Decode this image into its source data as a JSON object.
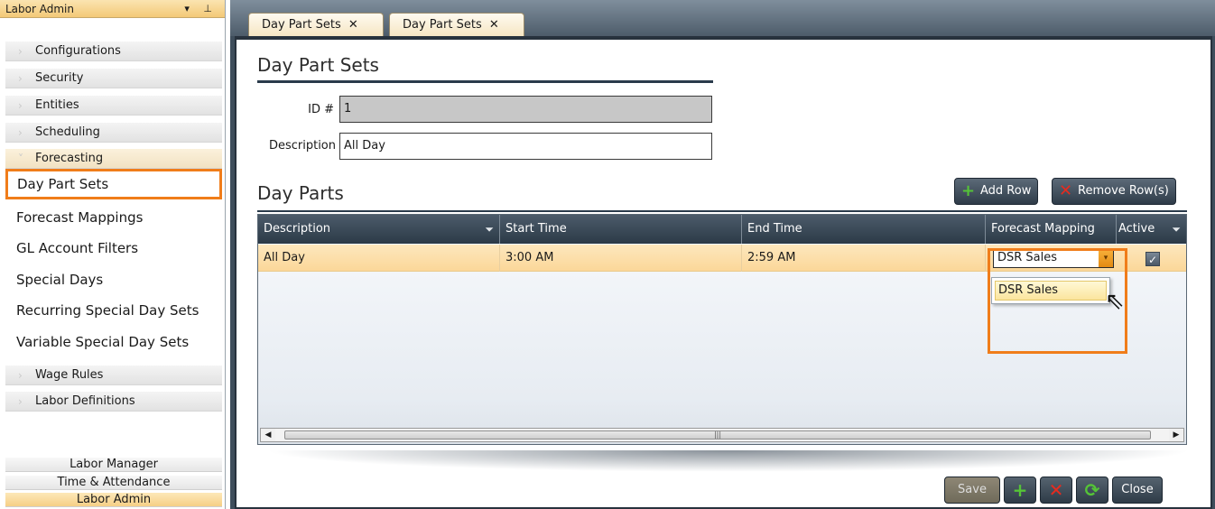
{
  "sidebar": {
    "title": "Labor Admin",
    "header_controls": "▾ ⊥",
    "groups_top": [
      {
        "label": "Configurations"
      },
      {
        "label": "Security"
      },
      {
        "label": "Entities"
      },
      {
        "label": "Scheduling"
      },
      {
        "label": "Forecasting"
      }
    ],
    "items": [
      {
        "label": "Day Part Sets"
      },
      {
        "label": "Forecast Mappings"
      },
      {
        "label": "GL Account Filters"
      },
      {
        "label": "Special Days"
      },
      {
        "label": "Recurring Special Day Sets"
      },
      {
        "label": "Variable Special Day Sets"
      }
    ],
    "groups_bottom": [
      {
        "label": "Wage Rules"
      },
      {
        "label": "Labor Definitions"
      }
    ],
    "footer": [
      {
        "label": "Labor Manager"
      },
      {
        "label": "Time & Attendance"
      },
      {
        "label": "Labor Admin"
      }
    ]
  },
  "tabs": [
    {
      "label": "Day Part Sets",
      "close": "✕"
    },
    {
      "label": "Day Part Sets",
      "close": "✕"
    }
  ],
  "form": {
    "title": "Day Part Sets",
    "id_label": "ID #",
    "id_value": "1",
    "desc_label": "Description",
    "desc_value": "All Day"
  },
  "day_parts": {
    "title": "Day Parts",
    "add_row": "Add Row",
    "remove_rows": "Remove Row(s)",
    "columns": [
      "Description",
      "Start Time",
      "End Time",
      "Forecast Mapping",
      "Active"
    ],
    "rows": [
      {
        "description": "All Day",
        "start_time": "3:00 AM",
        "end_time": "2:59 AM",
        "forecast_mapping": "DSR Sales",
        "active": "✓"
      }
    ],
    "dropdown_options": [
      "DSR Sales"
    ]
  },
  "footer_buttons": {
    "save": "Save",
    "close": "Close"
  },
  "icons": {
    "plus": "+",
    "cross": "✕",
    "refresh": "⟳",
    "filter": "⏷",
    "chevron": "›",
    "chevron_open": "˅",
    "scroll_left": "◀",
    "scroll_right": "▶",
    "scroll_grip": "|||",
    "dropdown_arrow": "▾"
  },
  "colors": {
    "highlight": "#f07d1a",
    "header_bg": "#2c3a47",
    "row_selected": "#fbd799"
  }
}
